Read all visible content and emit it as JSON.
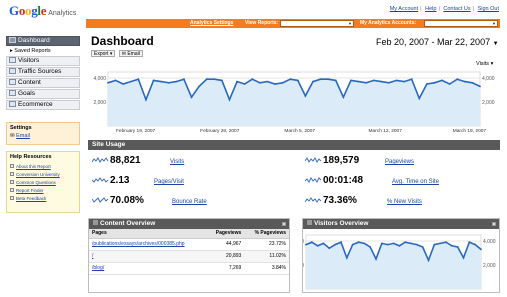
{
  "brand": {
    "google": "Google",
    "product": "Analytics"
  },
  "top_links": [
    "My Account",
    "Help",
    "Contact Us",
    "Sign Out"
  ],
  "orange_bar": {
    "settings": "Analytics Settings",
    "view_reports": "View Reports:",
    "my_accounts": "My Analytics Accounts:"
  },
  "sidebar": {
    "dashboard": "Dashboard",
    "saved_reports": "Saved Reports",
    "items": [
      "Visitors",
      "Traffic Sources",
      "Content",
      "Goals",
      "Ecommerce"
    ]
  },
  "settings_box": {
    "title": "Settings",
    "email": "Email"
  },
  "help": {
    "title": "Help Resources",
    "links": [
      "About this Report",
      "Conversion University",
      "Common Questions",
      "Report Finder",
      "Beta Feedback"
    ]
  },
  "page": {
    "title": "Dashboard",
    "export": "Export",
    "email": "Email",
    "date_range": "Feb 20, 2007 - Mar 22, 2007",
    "metric_select": "Visits"
  },
  "chart_data": [
    {
      "type": "line",
      "series": [
        {
          "name": "Visits",
          "values": [
            3600,
            3800,
            3500,
            3700,
            3900,
            2200,
            3800,
            3700,
            3600,
            3700,
            3900,
            2400,
            3300,
            3900,
            3900,
            3800,
            2200,
            3700,
            3500,
            3900,
            3600,
            3700,
            3500,
            3600,
            3900,
            3800,
            2500,
            3700,
            3900,
            3900,
            3800,
            2400,
            3800,
            3700,
            3600,
            3800,
            3700,
            3600,
            3800,
            3700,
            3900,
            2300,
            3500,
            3600,
            3800,
            3500,
            3900,
            3700,
            3600,
            3300
          ]
        }
      ],
      "y_ticks": [
        "4,000",
        "2,000"
      ],
      "x_labels": [
        "February 19, 2007",
        "February 26, 2007",
        "March 5, 2007",
        "March 12, 2007",
        "March 19, 2007"
      ],
      "ylim": [
        0,
        4500
      ]
    },
    {
      "type": "line",
      "series": [
        {
          "name": "Visits",
          "values": [
            3700,
            3900,
            3600,
            3800,
            3400,
            3700,
            3900,
            2600,
            3700,
            3900,
            3800,
            3500,
            2500,
            3800,
            3700,
            3800,
            3600,
            3900,
            3800,
            3700,
            3500,
            2400,
            3700,
            3800,
            3900,
            3600,
            3500,
            2600,
            3900,
            3700,
            3300
          ]
        }
      ],
      "y_ticks": [
        "4,000",
        "2,000"
      ],
      "ylim": [
        0,
        4500
      ]
    }
  ],
  "site_usage": {
    "title": "Site Usage",
    "metrics": [
      {
        "value": "88,821",
        "label": "Visits"
      },
      {
        "value": "189,579",
        "label": "Pageviews"
      },
      {
        "value": "2.13",
        "label": "Pages/Visit"
      },
      {
        "value": "00:01:48",
        "label": "Avg. Time on Site"
      },
      {
        "value": "70.08%",
        "label": "Bounce Rate"
      },
      {
        "value": "73.36%",
        "label": "% New Visits"
      }
    ]
  },
  "content_overview": {
    "title": "Content Overview",
    "headers": [
      "Pages",
      "Pageviews",
      "% Pageviews"
    ],
    "rows": [
      [
        "/publications/essays/archives/000385.php",
        "44,967",
        "23.72%"
      ],
      [
        "/",
        "20,893",
        "11.02%"
      ],
      [
        "/blog/",
        "7,269",
        "3.84%"
      ]
    ]
  },
  "visitors_overview": {
    "title": "Visitors Overview"
  }
}
